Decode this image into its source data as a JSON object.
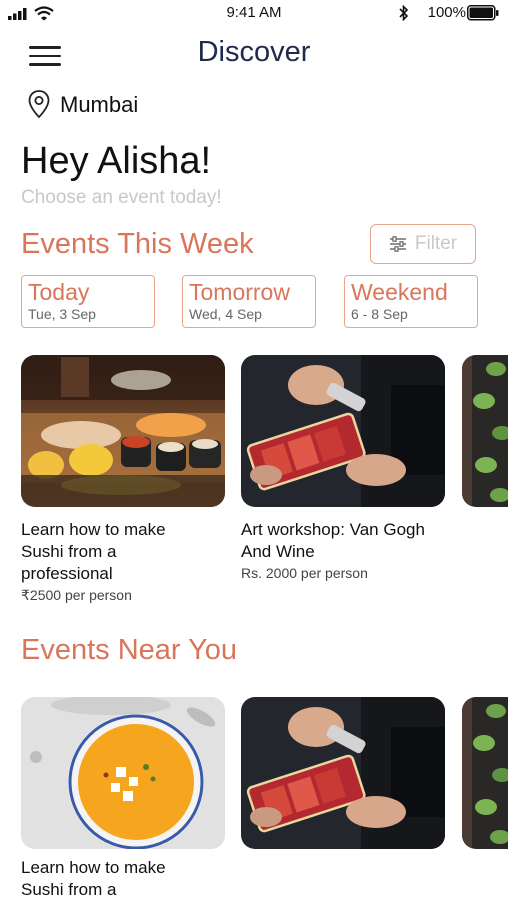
{
  "status_bar": {
    "time": "9:41 AM",
    "battery": "100%"
  },
  "header": {
    "title": "Discover"
  },
  "location": {
    "city": "Mumbai"
  },
  "greeting": {
    "title": "Hey Alisha!",
    "subtitle": "Choose an event today!"
  },
  "events_this_week": {
    "heading": "Events This Week",
    "filter_label": "Filter",
    "days": [
      {
        "label": "Today",
        "date": "Tue, 3 Sep"
      },
      {
        "label": "Tomorrow",
        "date": "Wed, 4 Sep"
      },
      {
        "label": "Weekend",
        "date": "6 - 8 Sep"
      }
    ],
    "cards": [
      {
        "title_line1": "Learn how to make",
        "title_line2": "Sushi from a",
        "title_line3": "professional",
        "price": "₹2500 per person"
      },
      {
        "title_line1": "Art workshop: Van Gogh",
        "title_line2": "And Wine",
        "price": "Rs. 2000 per person"
      }
    ]
  },
  "events_near_you": {
    "heading": "Events Near You",
    "cards": [
      {
        "title_line1": "Learn how to make",
        "title_line2": "Sushi from a"
      }
    ]
  },
  "colors": {
    "accent": "#d9765a",
    "title_navy": "#1f2a4d",
    "border": "#e9a58c"
  }
}
